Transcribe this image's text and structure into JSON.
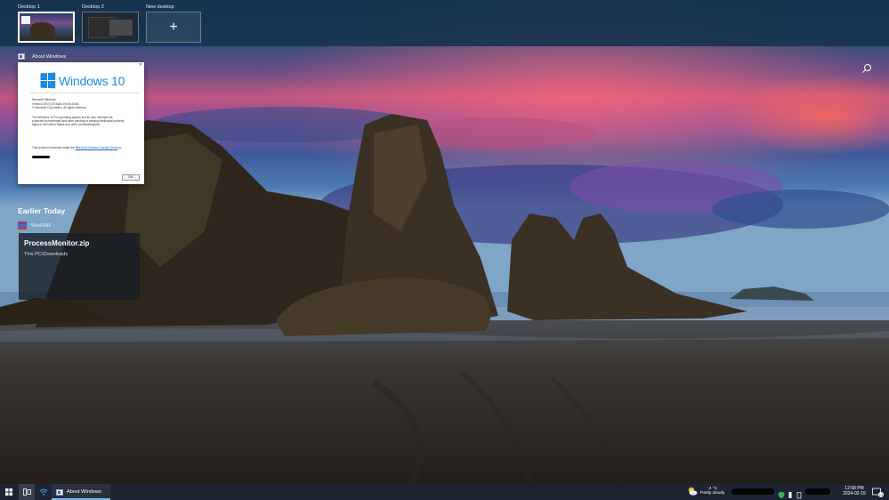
{
  "desktops": [
    {
      "label": "Desktop 1",
      "active": true
    },
    {
      "label": "Desktop 2",
      "active": false
    }
  ],
  "new_desktop": {
    "label": "New desktop",
    "glyph": "+"
  },
  "task_view_window": {
    "title": "About Windows",
    "logo_text": "Windows 10",
    "line1": "Microsoft Windows",
    "line2": "Version 22H2 (OS Build 19045.4046)",
    "line3": "© Microsoft Corporation. All rights reserved.",
    "paragraph": "The Windows 10 Pro operating system and its user interface are protected by trademark and other pending or existing intellectual property rights in the United States and other countries/regions.",
    "license_prefix": "This product is licensed under the ",
    "license_link": "Microsoft Software License Terms",
    "license_suffix": " to:",
    "ok_label": "OK"
  },
  "timeline": {
    "heading": "Earlier Today",
    "app_label": "WinRAR",
    "activity_title": "ProcessMonitor.zip",
    "activity_path": "This PC\\Downloads"
  },
  "taskbar": {
    "app_label": "About Windows",
    "weather_temp": "-4 °C",
    "weather_desc": "Partly cloudy",
    "time": "12:58 PM",
    "date": "2024-02-19",
    "notification_count": "13"
  },
  "icons": {
    "search": "search-icon",
    "start": "windows-start-icon",
    "task_view": "task-view-icon",
    "network": "wifi-icon",
    "weather": "partly-cloudy-icon",
    "notifications": "notification-icon"
  },
  "colors": {
    "desk_bar": "#16344e",
    "taskbar": "#1c2433",
    "windows_blue": "#1b8ae3",
    "taskbar_accent": "#76b9ed"
  }
}
